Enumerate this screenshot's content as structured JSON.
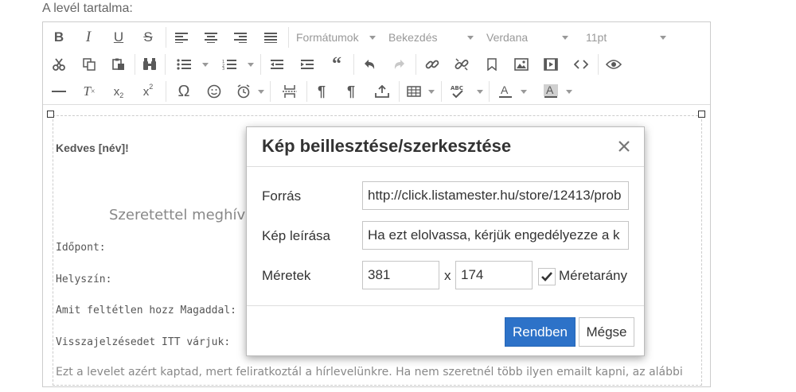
{
  "section_label": "A levél tartalma:",
  "toolbar": {
    "format_select": "Formátumok",
    "block_select": "Bekezdés",
    "font_select": "Verdana",
    "size_select": "11pt"
  },
  "content": {
    "greeting": "Kedves [név]!",
    "invite": "Szeretettel meghívu",
    "lines": [
      "Időpont:",
      "Helyszín:",
      "Amit feltétlen hozz Magaddal:",
      "Visszajelzésedet ITT várjuk:"
    ],
    "footer": "Ezt a levelet azért kaptad, mert feliratkoztál a hírlevelünkre. Ha nem szeretnél több ilyen emailt kapni, az alábbi"
  },
  "dialog": {
    "title": "Kép beillesztése/szerkesztése",
    "source_label": "Forrás",
    "source_value": "http://click.listamester.hu/store/12413/prob",
    "desc_label": "Kép leírása",
    "desc_value": "Ha ezt elolvassa, kérjük engedélyezze a k",
    "dims_label": "Méretek",
    "width_value": "381",
    "height_value": "174",
    "x_sep": "x",
    "ratio_label": "Méretarány",
    "ok_label": "Rendben",
    "cancel_label": "Mégse"
  }
}
